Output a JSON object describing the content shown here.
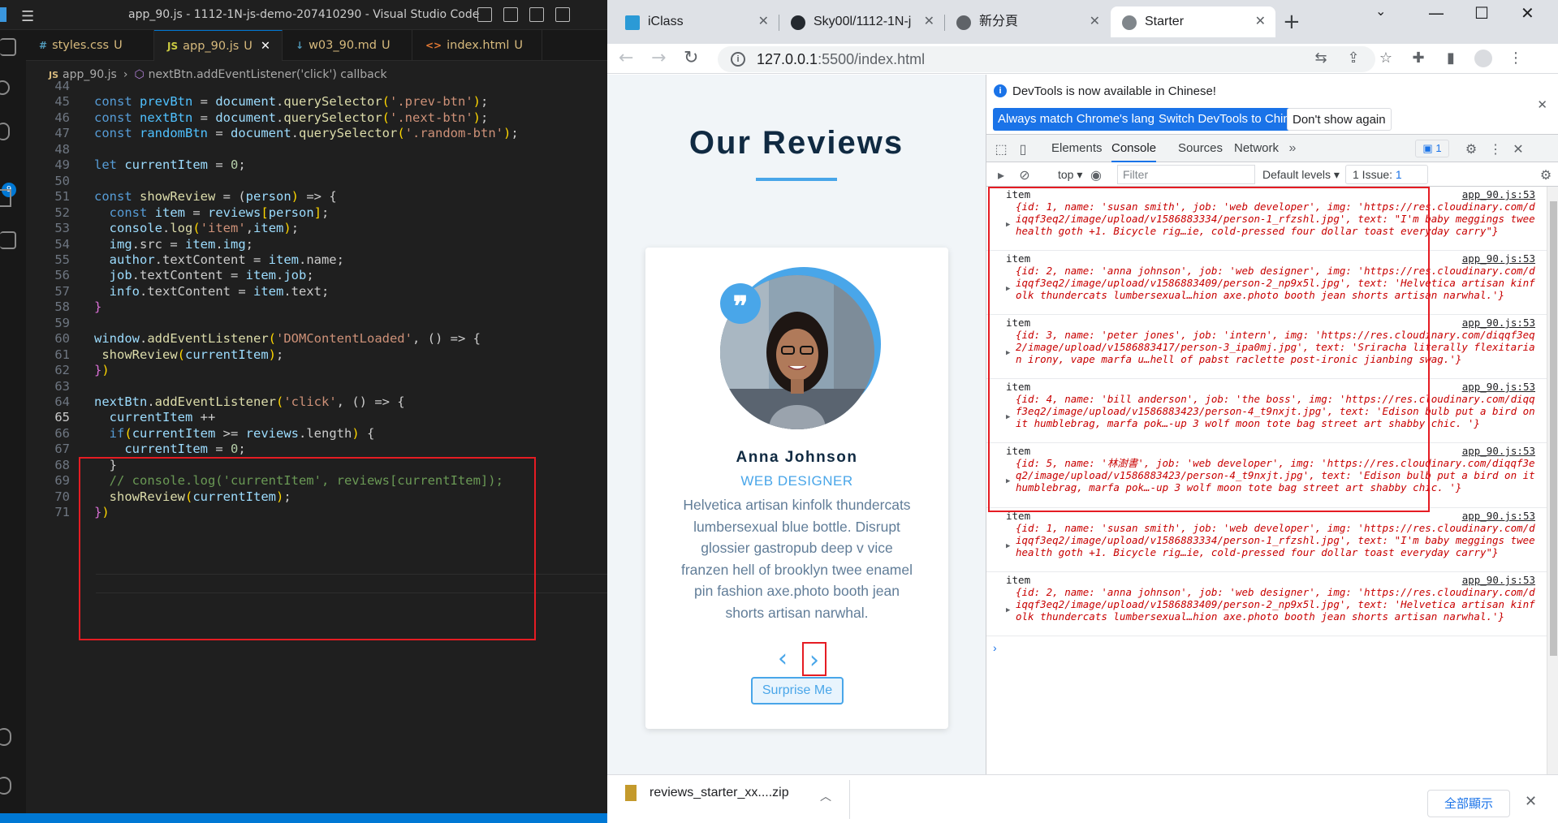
{
  "vscode": {
    "window_title": "app_90.js - 1112-1N-js-demo-207410290 - Visual Studio Code",
    "badge": "9",
    "tabs": [
      {
        "icon": "#",
        "label": "styles.css",
        "status": "U"
      },
      {
        "icon": "JS",
        "label": "app_90.js",
        "status": "U"
      },
      {
        "icon": "↓",
        "label": "w03_90.md",
        "status": "U"
      },
      {
        "icon": "<>",
        "label": "index.html",
        "status": "U"
      }
    ],
    "breadcrumb": {
      "file_icon": "JS",
      "file": "app_90.js",
      "symbol": "nextBtn.addEventListener('click') callback"
    },
    "current_line": "65",
    "lines": [
      {
        "n": "44",
        "t": ""
      },
      {
        "n": "45",
        "t": "const prevBtn = document.querySelector('.prev-btn');"
      },
      {
        "n": "46",
        "t": "const nextBtn = document.querySelector('.next-btn');"
      },
      {
        "n": "47",
        "t": "const randomBtn = document.querySelector('.random-btn');"
      },
      {
        "n": "48",
        "t": ""
      },
      {
        "n": "49",
        "t": "let currentItem = 0;"
      },
      {
        "n": "50",
        "t": ""
      },
      {
        "n": "51",
        "t": "const showReview = (person) => {"
      },
      {
        "n": "52",
        "t": "  const item = reviews[person];"
      },
      {
        "n": "53",
        "t": "  console.log('item',item);"
      },
      {
        "n": "54",
        "t": "  img.src = item.img;"
      },
      {
        "n": "55",
        "t": "  author.textContent = item.name;"
      },
      {
        "n": "56",
        "t": "  job.textContent = item.job;"
      },
      {
        "n": "57",
        "t": "  info.textContent = item.text;"
      },
      {
        "n": "58",
        "t": "}"
      },
      {
        "n": "59",
        "t": ""
      },
      {
        "n": "60",
        "t": "window.addEventListener('DOMContentLoaded', () => {"
      },
      {
        "n": "61",
        "t": " showReview(currentItem);"
      },
      {
        "n": "62",
        "t": "})"
      },
      {
        "n": "63",
        "t": ""
      },
      {
        "n": "64",
        "t": "nextBtn.addEventListener('click', () => {"
      },
      {
        "n": "65",
        "t": "  currentItem ++"
      },
      {
        "n": "66",
        "t": "  if(currentItem >= reviews.length) {"
      },
      {
        "n": "67",
        "t": "    currentItem = 0;"
      },
      {
        "n": "68",
        "t": "  }"
      },
      {
        "n": "69",
        "t": "  // console.log('currentItem', reviews[currentItem]);"
      },
      {
        "n": "70",
        "t": "  showReview(currentItem);"
      },
      {
        "n": "71",
        "t": "})"
      }
    ]
  },
  "chrome": {
    "tabs": [
      {
        "label": "iClass",
        "icon": "iclass-icon"
      },
      {
        "label": "Sky00l/1112-1N-j",
        "icon": "github-icon"
      },
      {
        "label": "新分頁",
        "icon": "chrome-icon"
      },
      {
        "label": "Starter",
        "icon": "globe-icon"
      }
    ],
    "url_host": "127.0.0.1",
    "url_rest": ":5500/index.html",
    "page": {
      "title": "Our Reviews",
      "author": "Anna Johnson",
      "job": "WEB DESIGNER",
      "info": "Helvetica artisan kinfolk thundercats lumbersexual blue bottle. Disrupt glossier gastropub deep v vice franzen hell of brooklyn twee enamel pin fashion axe.photo booth jean shorts artisan narwhal.",
      "quote_glyph": "❞",
      "prev_glyph": "‹",
      "next_glyph": "›",
      "random_label": "Surprise Me"
    },
    "devtools": {
      "banner_message": "DevTools is now available in Chinese!",
      "btn_always": "Always match Chrome's language",
      "btn_switch": "Switch DevTools to Chinese",
      "btn_dont_show": "Don't show again",
      "tabs": [
        "Elements",
        "Console",
        "Sources",
        "Network"
      ],
      "issues_badge": "1",
      "context": "top",
      "filter_placeholder": "Filter",
      "levels": "Default levels",
      "issue_count_label": "1 Issue:",
      "issue_count_value": "1",
      "logs": [
        {
          "label": "item",
          "src": "app_90.js:53",
          "obj": "{id: 1, name: 'susan smith', job: 'web developer', img: 'https://res.cloudinary.com/diqqf3eq2/image/upload/v1586883334/person-1_rfzshl.jpg', text: \"I'm baby meggings twee health goth +1. Bicycle rig…ie, cold-pressed four dollar toast everyday carry\"}"
        },
        {
          "label": "item",
          "src": "app_90.js:53",
          "obj": "{id: 2, name: 'anna johnson', job: 'web designer', img: 'https://res.cloudinary.com/diqqf3eq2/image/upload/v1586883409/person-2_np9x5l.jpg', text: 'Helvetica artisan kinfolk thundercats lumbersexual…hion axe.photo booth jean shorts artisan narwhal.'}"
        },
        {
          "label": "item",
          "src": "app_90.js:53",
          "obj": "{id: 3, name: 'peter jones', job: 'intern', img: 'https://res.cloudinary.com/diqqf3eq2/image/upload/v1586883417/person-3_ipa0mj.jpg', text: 'Sriracha literally flexitarian irony, vape marfa u…hell of pabst raclette post-ironic jianbing swag.'}"
        },
        {
          "label": "item",
          "src": "app_90.js:53",
          "obj": "{id: 4, name: 'bill anderson', job: 'the boss', img: 'https://res.cloudinary.com/diqqf3eq2/image/upload/v1586883423/person-4_t9nxjt.jpg', text: 'Edison bulb put a bird on it humblebrag, marfa pok…-up 3 wolf moon tote bag street art shabby chic. '}"
        },
        {
          "label": "item",
          "src": "app_90.js:53",
          "obj": "{id: 5, name: '林澍書', job: 'web developer', img: 'https://res.cloudinary.com/diqqf3eq2/image/upload/v1586883423/person-4_t9nxjt.jpg', text: 'Edison bulb put a bird on it humblebrag, marfa pok…-up 3 wolf moon tote bag street art shabby chic. '}"
        },
        {
          "label": "item",
          "src": "app_90.js:53",
          "obj": "{id: 1, name: 'susan smith', job: 'web developer', img: 'https://res.cloudinary.com/diqqf3eq2/image/upload/v1586883334/person-1_rfzshl.jpg', text: \"I'm baby meggings twee health goth +1. Bicycle rig…ie, cold-pressed four dollar toast everyday carry\"}"
        },
        {
          "label": "item",
          "src": "app_90.js:53",
          "obj": "{id: 2, name: 'anna johnson', job: 'web designer', img: 'https://res.cloudinary.com/diqqf3eq2/image/upload/v1586883409/person-2_np9x5l.jpg', text: 'Helvetica artisan kinfolk thundercats lumbersexual…hion axe.photo booth jean shorts artisan narwhal.'}"
        }
      ],
      "prompt": "›"
    },
    "download": {
      "file": "reviews_starter_xx....zip",
      "show_all": "全部顯示"
    }
  },
  "colors": {
    "accent_blue": "#49a6e9",
    "highlight_red": "#e51c23",
    "vscode_bg": "#1f1f1f"
  }
}
